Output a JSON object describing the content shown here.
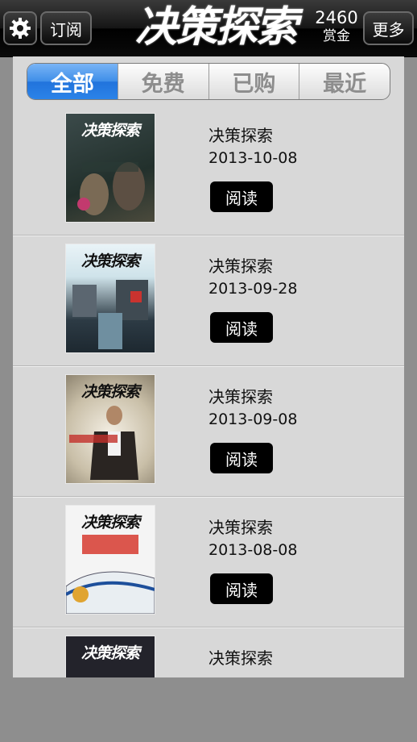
{
  "header": {
    "title": "决策探索",
    "subscribe_label": "订阅",
    "more_label": "更多",
    "bounty_value": "2460",
    "bounty_label": "赏金"
  },
  "tabs": [
    {
      "label": "全部",
      "active": true
    },
    {
      "label": "免费",
      "active": false
    },
    {
      "label": "已购",
      "active": false
    },
    {
      "label": "最近",
      "active": false
    }
  ],
  "issues": [
    {
      "title": "决策探索",
      "date": "2013-10-08",
      "read_label": "阅读",
      "cover_title": "决策探索"
    },
    {
      "title": "决策探索",
      "date": "2013-09-28",
      "read_label": "阅读",
      "cover_title": "决策探索"
    },
    {
      "title": "决策探索",
      "date": "2013-09-08",
      "read_label": "阅读",
      "cover_title": "决策探索"
    },
    {
      "title": "决策探索",
      "date": "2013-08-08",
      "read_label": "阅读",
      "cover_title": "决策探索"
    },
    {
      "title": "决策探索",
      "cover_title": "决策探索"
    }
  ],
  "colors": {
    "accent": "#2b83e8",
    "header_bg": "#000000",
    "panel_bg": "#d8d8d8"
  }
}
